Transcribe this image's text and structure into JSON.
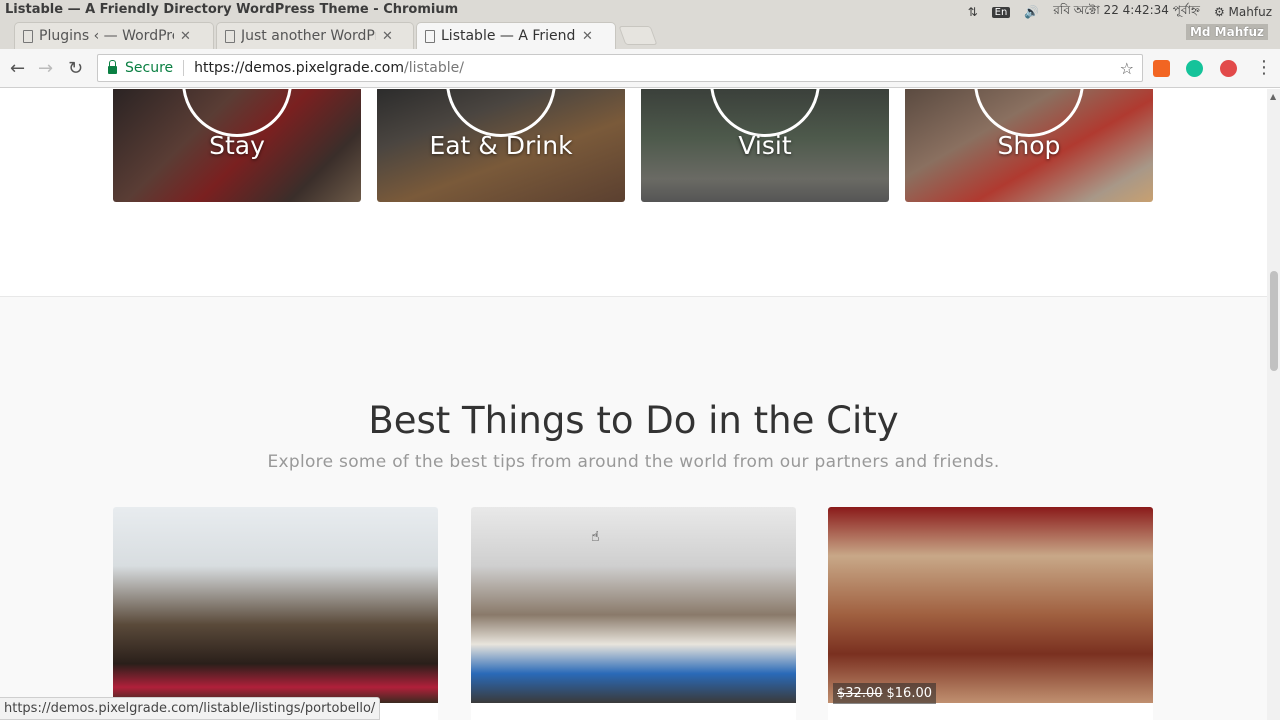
{
  "window": {
    "title": "Listable — A Friendly Directory WordPress Theme - Chromium",
    "tray_lang": "En",
    "tray_datetime": "রবি অক্টো 22  4:42:34 পূর্বাহ্ন",
    "tray_user": "Mahfuz"
  },
  "tabs": [
    {
      "label": "Plugins ‹ — WordPress"
    },
    {
      "label": "Just another WordPress"
    },
    {
      "label": "Listable — A Friendly"
    }
  ],
  "profile_name": "Md Mahfuz",
  "address": {
    "secure_label": "Secure",
    "url_host": "https://demos.pixelgrade.com",
    "url_path": "/listable/"
  },
  "categories": [
    {
      "label": "Stay"
    },
    {
      "label": "Eat & Drink"
    },
    {
      "label": "Visit"
    },
    {
      "label": "Shop"
    }
  ],
  "section": {
    "title": "Best Things to Do in the City",
    "subtitle": "Explore some of the best tips from around the world from our partners and friends."
  },
  "listings": [
    {
      "old_price": "",
      "new_price": ""
    },
    {
      "old_price": "",
      "new_price": ""
    },
    {
      "old_price": "$32.00",
      "new_price": "$16.00"
    }
  ],
  "status_url": "https://demos.pixelgrade.com/listable/listings/portobello/",
  "colors": {
    "secure_green": "#0b8043",
    "text_heading": "#333333",
    "text_muted": "#999999"
  }
}
